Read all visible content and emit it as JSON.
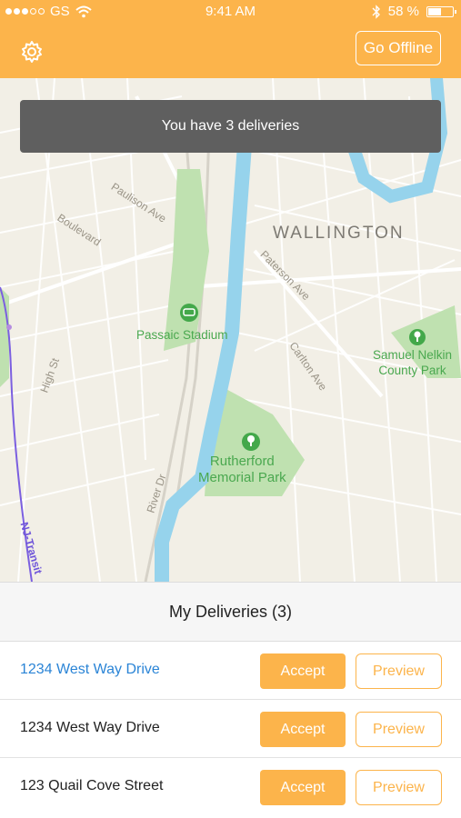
{
  "status_bar": {
    "carrier": "GS",
    "time": "9:41 AM",
    "battery": "58 %",
    "battery_level": 0.58
  },
  "header": {
    "settings_icon": "gear-icon",
    "offline_label": "Go Offline"
  },
  "toast": {
    "message": "You have 3 deliveries"
  },
  "map": {
    "labels": {
      "wallington": "WALLINGTON",
      "paulison": "Paulison Ave",
      "boulevard": "Boulevard",
      "paterson": "Paterson Ave",
      "high": "High St",
      "carlton": "Carlton Ave",
      "river": "River Dr",
      "nj_transit": "NJ-Transit"
    },
    "parks": {
      "passaic_stadium": "Passaic Stadium",
      "samuel_1": "Samuel Nelkin",
      "samuel_2": "County Park",
      "rutherford_1": "Rutherford",
      "rutherford_2": "Memorial Park"
    }
  },
  "deliveries": {
    "title": "My Deliveries (3)",
    "accept_label": "Accept",
    "preview_label": "Preview",
    "items": [
      {
        "address": "1234 West Way Drive"
      },
      {
        "address": "1234 West Way Drive"
      },
      {
        "address": "123 Quail Cove Street"
      }
    ]
  },
  "colors": {
    "accent": "#fcb44b",
    "link": "#2a84d6",
    "toast": "#5f5f5f"
  }
}
